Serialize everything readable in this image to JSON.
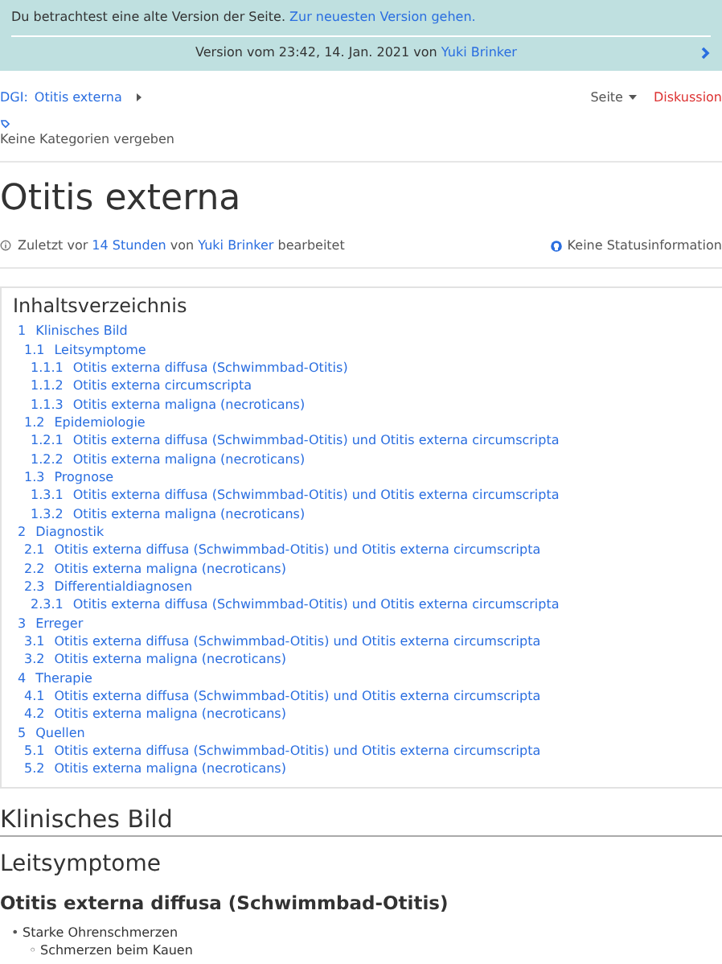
{
  "banner": {
    "notice": "Du betrachtest eine alte Version der Seite.",
    "notice_link": "Zur neuesten Version gehen.",
    "version_text": "Version vom 23:42, 14. Jan. 2021 von",
    "version_author": "Yuki Brinker"
  },
  "breadcrumb": {
    "prefix": "DGI:",
    "title": "Otitis externa"
  },
  "page_tabs": [
    {
      "label": "Seite",
      "kind": "dropdown"
    },
    {
      "label": "Diskussion",
      "kind": "missing"
    }
  ],
  "categories": "Keine Kategorien vergeben",
  "title": "Otitis externa",
  "meta": {
    "prefix": "Zuletzt vor",
    "time": "14 Stunden",
    "middle": "von",
    "author": "Yuki Brinker",
    "suffix": "bearbeitet",
    "status": "Keine Statusinformation"
  },
  "toc": {
    "title": "Inhaltsverzeichnis",
    "items": [
      {
        "number": "1",
        "text": "Klinisches Bild",
        "children": [
          {
            "number": "1.1",
            "text": "Leitsymptome",
            "children": [
              {
                "number": "1.1.1",
                "text": "Otitis externa diffusa (Schwimmbad-Otitis)"
              },
              {
                "number": "1.1.2",
                "text": "Otitis externa circumscripta"
              },
              {
                "number": "1.1.3",
                "text": "Otitis externa maligna (necroticans)"
              }
            ]
          },
          {
            "number": "1.2",
            "text": "Epidemiologie",
            "children": [
              {
                "number": "1.2.1",
                "text": "Otitis externa diffusa (Schwimmbad-Otitis) und Otitis externa circumscripta"
              },
              {
                "number": "1.2.2",
                "text": "Otitis externa maligna (necroticans)"
              }
            ]
          },
          {
            "number": "1.3",
            "text": "Prognose",
            "children": [
              {
                "number": "1.3.1",
                "text": "Otitis externa diffusa (Schwimmbad-Otitis) und Otitis externa circumscripta"
              },
              {
                "number": "1.3.2",
                "text": "Otitis externa maligna (necroticans)"
              }
            ]
          }
        ]
      },
      {
        "number": "2",
        "text": "Diagnostik",
        "children": [
          {
            "number": "2.1",
            "text": "Otitis externa diffusa (Schwimmbad-Otitis) und Otitis externa circumscripta"
          },
          {
            "number": "2.2",
            "text": "Otitis externa maligna (necroticans)"
          },
          {
            "number": "2.3",
            "text": "Differentialdiagnosen",
            "children": [
              {
                "number": "2.3.1",
                "text": "Otitis externa diffusa (Schwimmbad-Otitis) und Otitis externa circumscripta"
              }
            ]
          }
        ]
      },
      {
        "number": "3",
        "text": "Erreger",
        "children": [
          {
            "number": "3.1",
            "text": "Otitis externa diffusa (Schwimmbad-Otitis) und Otitis externa circumscripta"
          },
          {
            "number": "3.2",
            "text": "Otitis externa maligna (necroticans)"
          }
        ]
      },
      {
        "number": "4",
        "text": "Therapie",
        "children": [
          {
            "number": "4.1",
            "text": "Otitis externa diffusa (Schwimmbad-Otitis) und Otitis externa circumscripta"
          },
          {
            "number": "4.2",
            "text": "Otitis externa maligna (necroticans)"
          }
        ]
      },
      {
        "number": "5",
        "text": "Quellen",
        "children": [
          {
            "number": "5.1",
            "text": "Otitis externa diffusa (Schwimmbad-Otitis) und Otitis externa circumscripta"
          },
          {
            "number": "5.2",
            "text": "Otitis externa maligna (necroticans)"
          }
        ]
      }
    ]
  },
  "content": {
    "h2": "Klinisches Bild",
    "h3": "Leitsymptome",
    "h4": "Otitis externa diffusa (Schwimmbad-Otitis)",
    "list": [
      {
        "marker": "•",
        "text": "Starke Ohrenschmerzen",
        "children": [
          {
            "marker": "◦",
            "text": "Schmerzen beim Kauen"
          }
        ]
      }
    ]
  }
}
